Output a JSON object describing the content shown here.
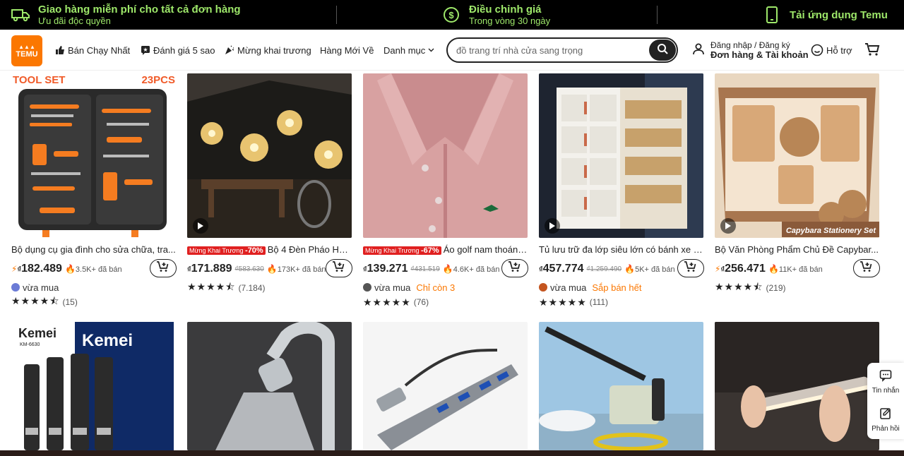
{
  "promo": {
    "shipping_title": "Giao hàng miễn phí cho tất cả đơn hàng",
    "shipping_sub": "Ưu đãi độc quyền",
    "adjust_title": "Điều chỉnh giá",
    "adjust_sub": "Trong vòng 30 ngày",
    "app_label": "Tải ứng dụng Temu"
  },
  "header": {
    "logo_top": "▲▲▲",
    "logo_text": "TEMU",
    "nav": [
      "Bán Chạy Nhất",
      "Đánh giá 5 sao",
      "Mừng khai trương",
      "Hàng Mới Về",
      "Danh mục"
    ],
    "search_placeholder": "đồ trang trí nhà cửa sang trọng",
    "account_line1": "Đăng nhập / Đăng ký",
    "account_line2": "Đơn hàng & Tài khoản",
    "help": "Hỗ trợ"
  },
  "products": [
    {
      "title": "Bộ dụng cụ gia đình cho sửa chữa, tra...",
      "price": "182.489",
      "old": "",
      "sold": "3.5K+ đã bán",
      "buyer": "vừa mua",
      "extra": "",
      "rating_count": "(15)",
      "badge": false,
      "flash": true,
      "img_label_l": "TOOL SET",
      "img_label_r": "23PCS"
    },
    {
      "title": "Bộ 4 Đèn Pháo Hoa Nă...",
      "price": "171.889",
      "old": "₫583.630",
      "sold": "173K+ đã bán",
      "buyer": "",
      "extra": "",
      "rating_count": "(7.184)",
      "badge": true,
      "badge_pct": "-70%",
      "flash": false
    },
    {
      "title": "Áo golf nam thoáng khí ...",
      "price": "139.271",
      "old": "₫431.519",
      "sold": "4.6K+ đã bán",
      "buyer": "vừa mua",
      "extra": "Chỉ còn 3",
      "rating_count": "(76)",
      "badge": true,
      "badge_pct": "-67%",
      "flash": false
    },
    {
      "title": "Tủ lưu trữ đa lớp siêu lớn có bánh xe v...",
      "price": "457.774",
      "old": "₫1.259.490",
      "sold": "5K+ đã bán",
      "buyer": "vừa mua",
      "extra": "Sắp bán hết",
      "rating_count": "(111)",
      "badge": false,
      "flash": false
    },
    {
      "title": "Bộ Văn Phòng Phẩm Chủ Đề Capybar...",
      "price": "256.471",
      "old": "",
      "sold": "11K+ đã bán",
      "buyer": "",
      "extra": "",
      "rating_count": "(219)",
      "badge": false,
      "flash": true,
      "img_label_r": "Capybara Stationery Set"
    }
  ],
  "badge_text": "Mừng Khai Trương",
  "currency": "₫",
  "second_row_labels": {
    "kemei": "Kemei",
    "kemei_model": "KM-6630"
  },
  "side": {
    "chat": "Tin nhắn",
    "feedback": "Phản hồi"
  },
  "colors": {
    "brand": "#fb7701",
    "promo_green": "#9ee86a",
    "sale_red": "#e02020"
  }
}
